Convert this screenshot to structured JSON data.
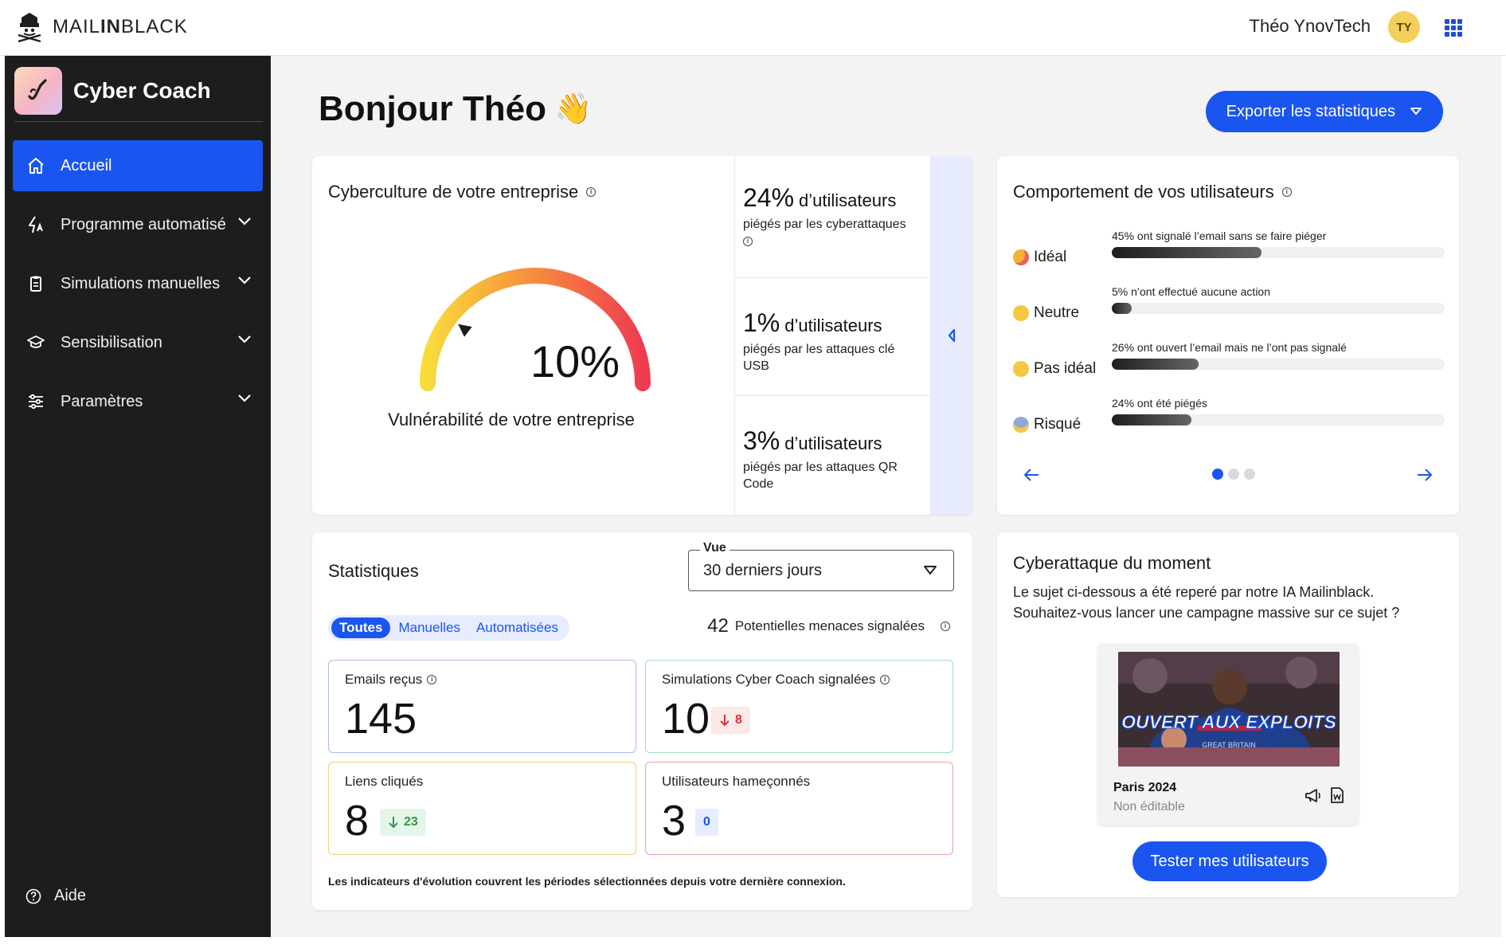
{
  "topbar": {
    "logo_light_1": "MAIL",
    "logo_bold": "IN",
    "logo_light_2": "BLACK",
    "user_name": "Théo YnovTech",
    "avatar_initials": "TY"
  },
  "sidebar": {
    "brand": "Cyber Coach",
    "items": [
      {
        "label": "Accueil",
        "icon": "home-icon",
        "active": true
      },
      {
        "label": "Programme automatisé",
        "icon": "automation-icon",
        "expandable": true
      },
      {
        "label": "Simulations manuelles",
        "icon": "clipboard-icon",
        "expandable": true
      },
      {
        "label": "Sensibilisation",
        "icon": "graduation-cap-icon",
        "expandable": true
      },
      {
        "label": "Paramètres",
        "icon": "sliders-icon",
        "expandable": true
      }
    ],
    "help_label": "Aide"
  },
  "header": {
    "greeting": "Bonjour Théo",
    "greeting_emoji": "👋",
    "export_label": "Exporter les statistiques"
  },
  "cyberculture": {
    "title": "Cyberculture de votre entreprise",
    "gauge_value": "10%",
    "gauge_fraction": 0.1,
    "gauge_label": "Vulnérabilité de votre entreprise",
    "kpis": [
      {
        "value": "24%",
        "unit": "d’utilisateurs",
        "desc": "piégés par les cyberattaques"
      },
      {
        "value": "1%",
        "unit": "d’utilisateurs",
        "desc": "piégés par les attaques clé USB"
      },
      {
        "value": "3%",
        "unit": "d’utilisateurs",
        "desc": "piégés par les attaques QR Code"
      }
    ]
  },
  "behavior": {
    "title": "Comportement de vos utilisateurs",
    "rows": [
      {
        "label": "Idéal",
        "caption": "45%  ont signalé l’email sans se faire piéger",
        "fraction": 0.45,
        "emoji_color": "#f2b233"
      },
      {
        "label": "Neutre",
        "caption": "5% n’ont effectué aucune action",
        "fraction": 0.05,
        "emoji_color": "#f5c842"
      },
      {
        "label": "Pas idéal",
        "caption": "26% ont ouvert l’email mais ne l’ont pas signalé",
        "fraction": 0.26,
        "emoji_color": "#f5c842"
      },
      {
        "label": "Risqué",
        "caption": "24% ont été piégés",
        "fraction": 0.24,
        "emoji_color": "#8fa8d8"
      }
    ],
    "page_index": 1,
    "page_count": 3
  },
  "stats": {
    "title": "Statistiques",
    "view_label": "Vue",
    "view_value": "30 derniers jours",
    "filters": [
      "Toutes",
      "Manuelles",
      "Automatisées"
    ],
    "active_filter": "Toutes",
    "threat_count": "42",
    "threat_label": "Potentielles menaces signalées",
    "metrics": [
      {
        "title": "Emails reçus",
        "value": "145",
        "border": "#a9bce8",
        "info": true
      },
      {
        "title": "Simulations Cyber Coach signalées",
        "value": "10",
        "border": "#9fe0b3",
        "info": true,
        "delta": "8",
        "delta_dir": "down",
        "delta_color": "#e03131",
        "delta_bg": "#fde8e8"
      },
      {
        "title": "Liens cliqués",
        "value": "8",
        "border": "#f1d27a",
        "delta": "23",
        "delta_dir": "down",
        "delta_color": "#2b9a4a",
        "delta_bg": "#e4f6e9"
      },
      {
        "title": "Utilisateurs hameçonnés",
        "value": "3",
        "border": "#eaa0a0",
        "delta": "0",
        "delta_color": "#1b55f0",
        "delta_bg": "#e7ecff"
      }
    ],
    "footnote": "Les indicateurs d'évolution couvrent les périodes sélectionnées depuis votre dernière connexion."
  },
  "featured": {
    "title": "Cyberattaque du moment",
    "description": "Le sujet ci-dessous a été reperé par notre IA Mailinblack. Souhaitez-vous lancer une campagne massive sur ce sujet ?",
    "image_text": "OUVERT AUX EXPLOITS",
    "image_small_text": "GREAT BRITAIN",
    "campaign_name": "Paris 2024",
    "campaign_status": "Non éditable",
    "cta_label": "Tester mes utilisateurs"
  },
  "colors": {
    "accent": "#1b55f0",
    "sidebar_bg": "#1d1d1d",
    "main_bg": "#f3f3f3"
  }
}
